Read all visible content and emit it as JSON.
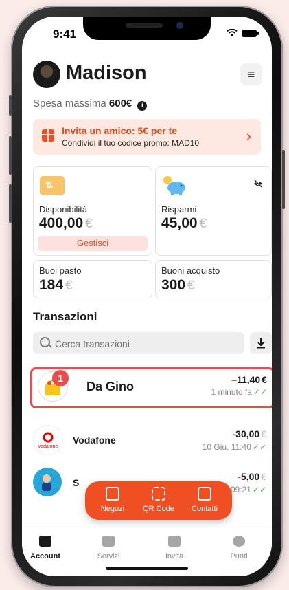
{
  "status": {
    "time": "9:41"
  },
  "header": {
    "name": "Madison"
  },
  "spesa": {
    "label": "Spesa massima",
    "value": "600€"
  },
  "promo": {
    "title": "Invita un amico: 5€ per te",
    "subtitle": "Condividi il tuo codice promo: MAD10"
  },
  "cards": {
    "disponibilita": {
      "label": "Disponibilità",
      "amount": "400,00",
      "currency": "€",
      "button": "Gestisci"
    },
    "risparmi": {
      "label": "Risparmi",
      "amount": "45,00",
      "currency": "€"
    },
    "buoni_pasto": {
      "label": "Buoi pasto",
      "amount": "184",
      "currency": "€"
    },
    "buoni_acquisto": {
      "label": "Buoni acquisto",
      "amount": "300",
      "currency": "€"
    }
  },
  "transactions": {
    "title": "Transazioni",
    "search_placeholder": "Cerca transazioni",
    "step_badge": "1",
    "items": [
      {
        "name": "Da Gino",
        "sign": "–",
        "amount": "11,40",
        "currency": "€",
        "date": "1 minuto fa"
      },
      {
        "name": "Vodafone",
        "sign": "-",
        "amount": "30,00",
        "currency": "€",
        "date": "10 Giu, 11:40",
        "logo_text": "vodafone"
      },
      {
        "name": "S",
        "sign": "-",
        "amount": "5,00",
        "currency": "€",
        "date": ", 09:21"
      }
    ]
  },
  "fab": {
    "items": [
      "Negozi",
      "QR Code",
      "Contatti"
    ]
  },
  "tabbar": {
    "items": [
      "Account",
      "Servizi",
      "Invita",
      "Punti"
    ],
    "active": "Account"
  },
  "colors": {
    "brand": "#f04e23",
    "highlight": "#e84c4c",
    "check": "#4caf50"
  }
}
